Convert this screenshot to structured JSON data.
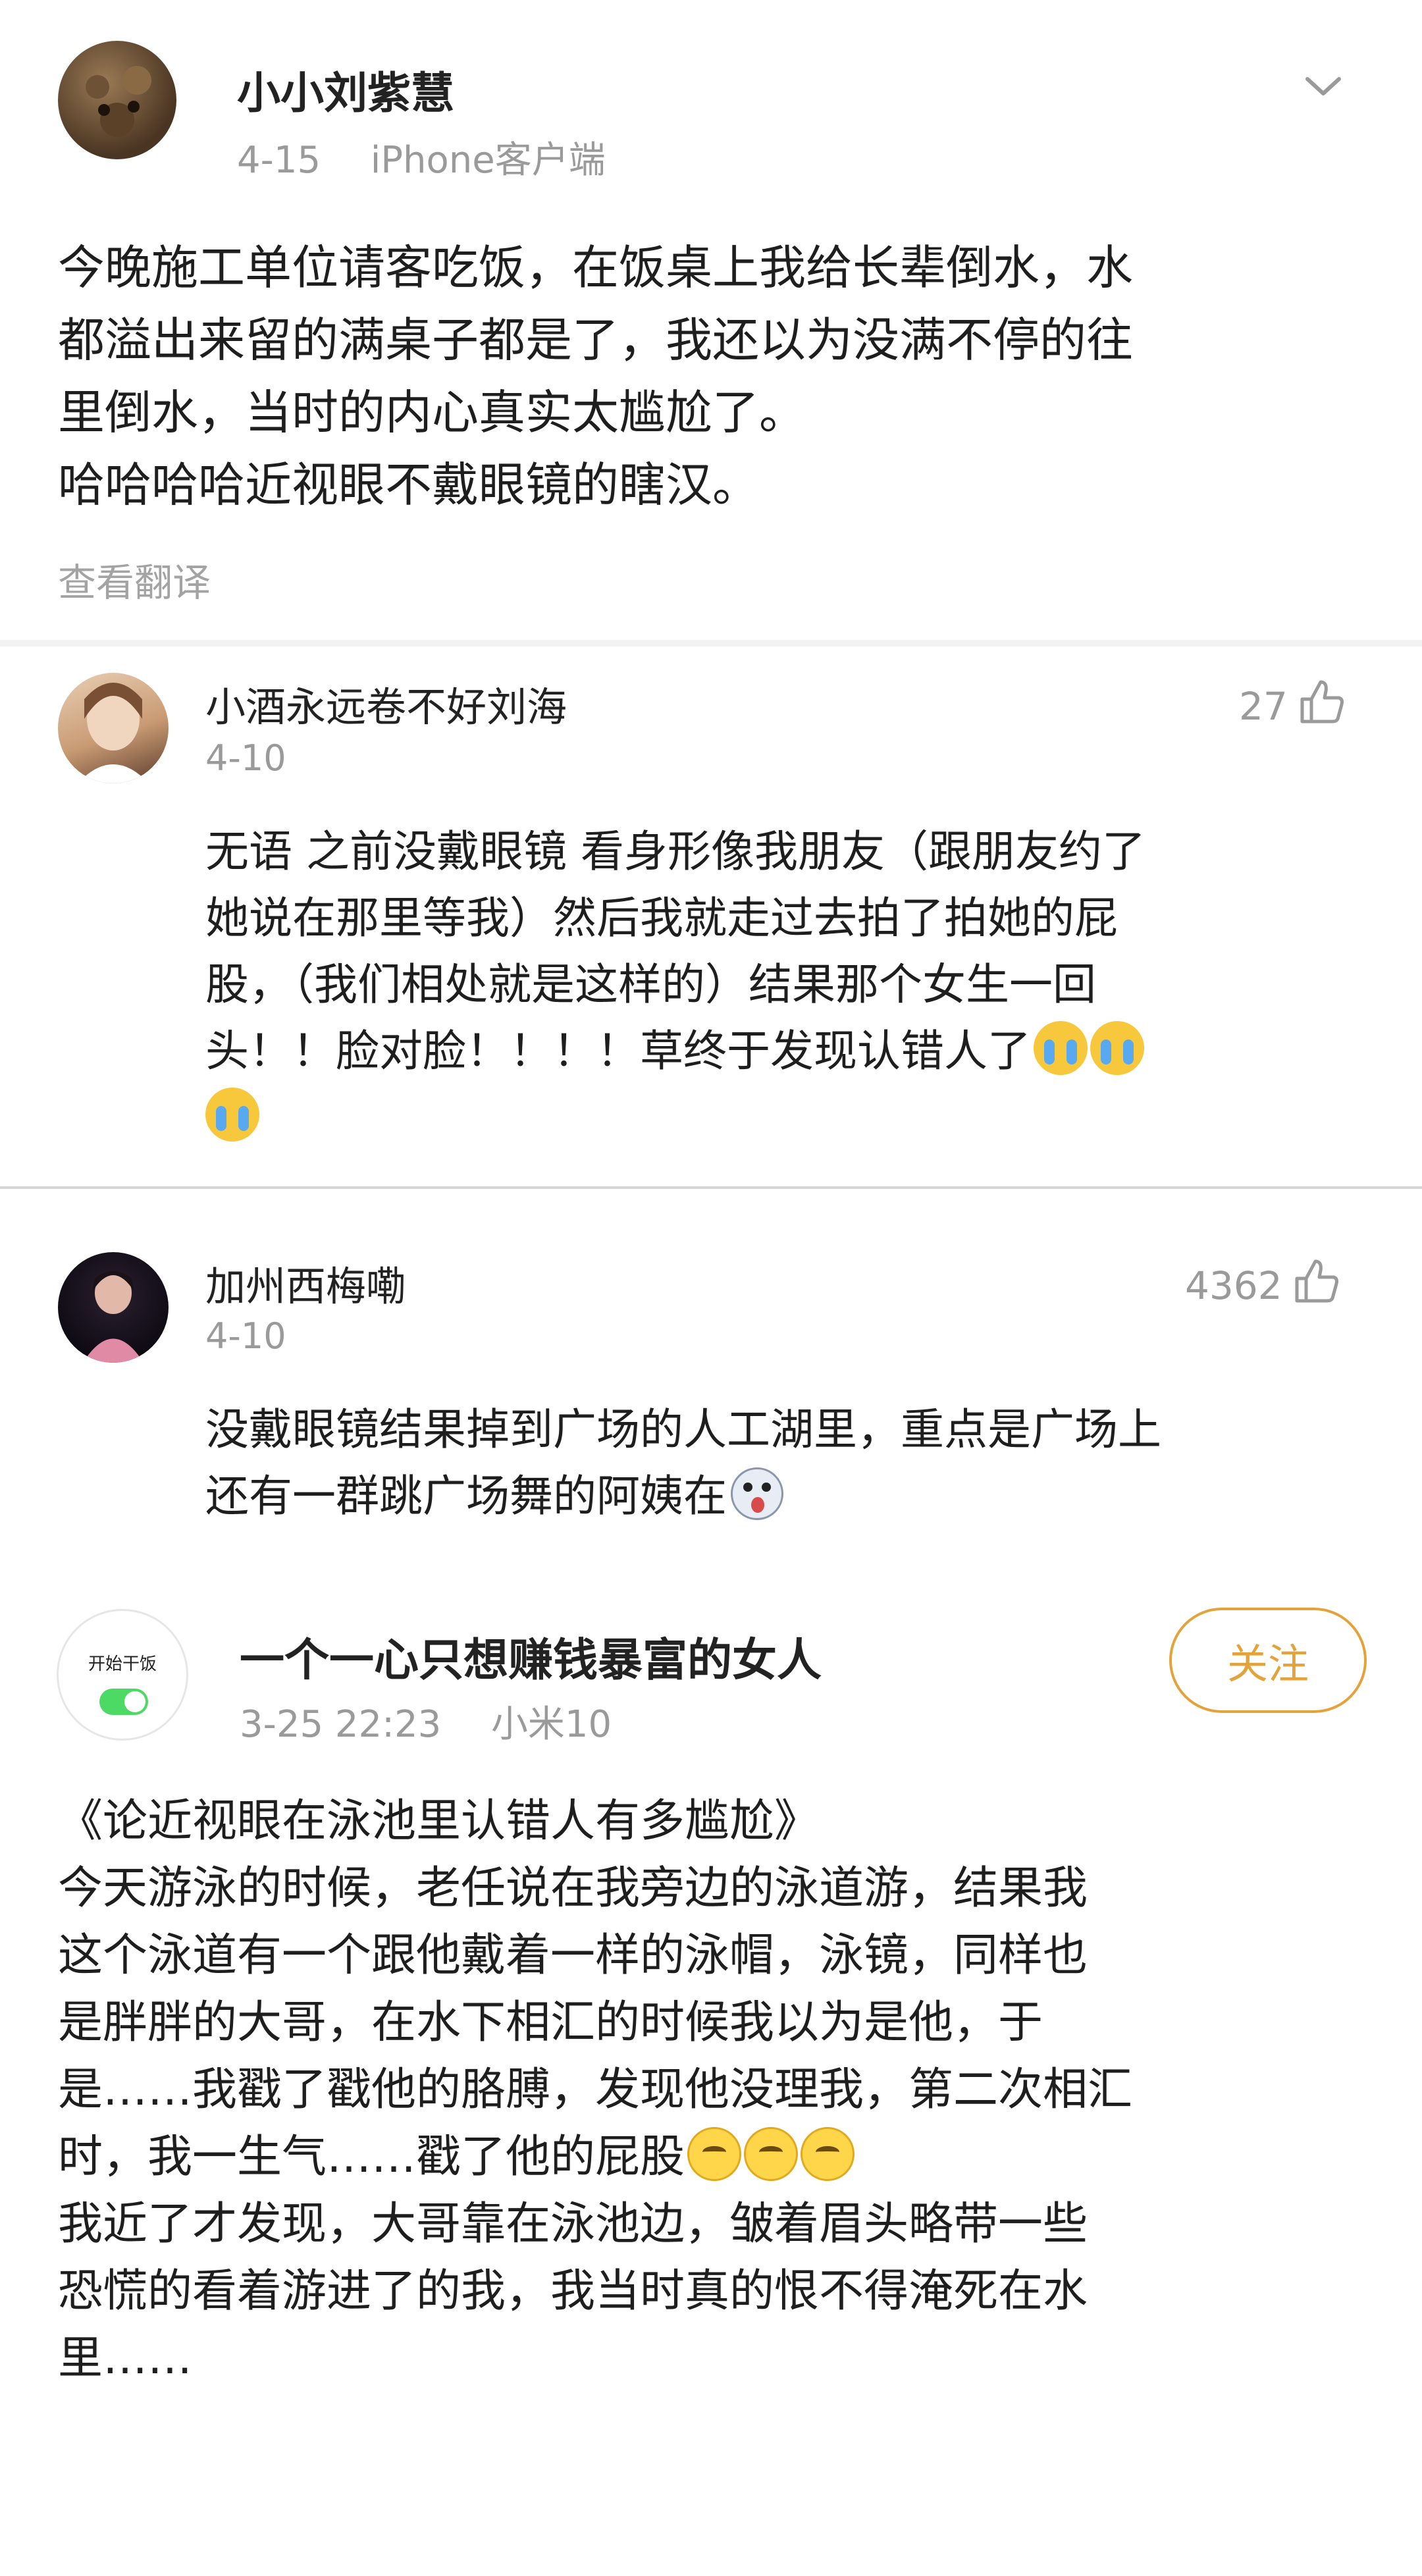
{
  "post": {
    "author": "小小刘紫慧",
    "date": "4-15",
    "device": "iPhone客户端",
    "body_lines": [
      "今晚施工单位请客吃饭，在饭桌上我给长辈倒水，水",
      "都溢出来留的满桌子都是了，我还以为没满不停的往",
      "里倒水，当时的内心真实太尴尬了。"
    ],
    "body_line2": "哈哈哈哈近视眼不戴眼镜的瞎汉。",
    "translate": "查看翻译",
    "menu_icon": "chevron-down-icon"
  },
  "comments": [
    {
      "name": "小酒永远卷不好刘海",
      "date": "4-10",
      "likes": "27",
      "text_lines": [
        "无语   之前没戴眼镜 看身形像我朋友（跟朋友约了",
        "她说在那里等我）然后我就走过去拍了拍她的屁",
        "股，（我们相处就是这样的）结果那个女生一回",
        "头！！脸对脸！！！！草终于发现认错人了"
      ],
      "emoji": "crying-emoji"
    },
    {
      "name": "加州西梅嘞",
      "date": "4-10",
      "likes": "4362",
      "text_lines": [
        "没戴眼镜结果掉到广场的人工湖里，重点是广场上",
        "还有一群跳广场舞的阿姨在"
      ],
      "emoji": "shocked-emoji"
    }
  ],
  "post2": {
    "avatar_label": "开始干饭",
    "author": "一个一心只想赚钱暴富的女人",
    "date": "3-25 22:23",
    "device": "小米10",
    "follow": "关注",
    "lines": [
      "《论近视眼在泳池里认错人有多尴尬》",
      "今天游泳的时候，老任说在我旁边的泳道游，结果我",
      "这个泳道有一个跟他戴着一样的泳帽，泳镜，同样也",
      "是胖胖的大哥，在水下相汇的时候我以为是他，于",
      "是……我戳了戳他的胳膊，发现他没理我，第二次相汇",
      "时，我一生气……戳了他的屁股",
      "我近了才发现，大哥靠在泳池边，皱着眉头略带一些",
      "恐慌的看着游进了的我，我当时真的恨不得淹死在水",
      "里……"
    ]
  },
  "colors": {
    "accent_follow": "#e4a23a",
    "meta_gray": "#9a9a9a",
    "toggle_green": "#4cd964"
  }
}
